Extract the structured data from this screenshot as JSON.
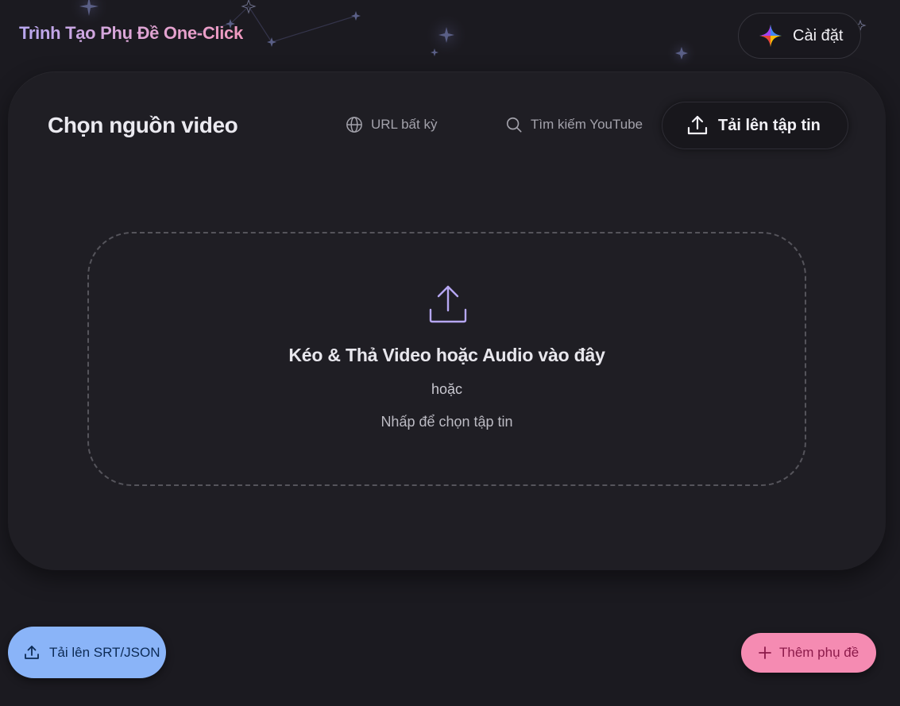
{
  "header": {
    "app_title": "Trình Tạo Phụ Đề One-Click",
    "settings_label": "Cài đặt"
  },
  "source_card": {
    "title": "Chọn nguồn video",
    "tabs": [
      {
        "label": "URL bất kỳ",
        "icon": "globe-icon",
        "active": false
      },
      {
        "label": "Tìm kiếm YouTube",
        "icon": "search-icon",
        "active": false
      },
      {
        "label": "Tải lên tập tin",
        "icon": "upload-icon",
        "active": true
      }
    ]
  },
  "dropzone": {
    "title": "Kéo & Thả Video hoặc Audio vào đây",
    "or_text": "hoặc",
    "click_text": "Nhấp để chọn tập tin"
  },
  "footer": {
    "upload_srt_label": "Tải lên SRT/JSON",
    "add_subtitle_label": "Thêm phụ đề"
  },
  "colors": {
    "background": "#1b1a20",
    "card": "#1f1e24",
    "accent_blue": "#8ab4f8",
    "accent_pink": "#f58bb2",
    "upload_icon": "#b6a7f2"
  }
}
